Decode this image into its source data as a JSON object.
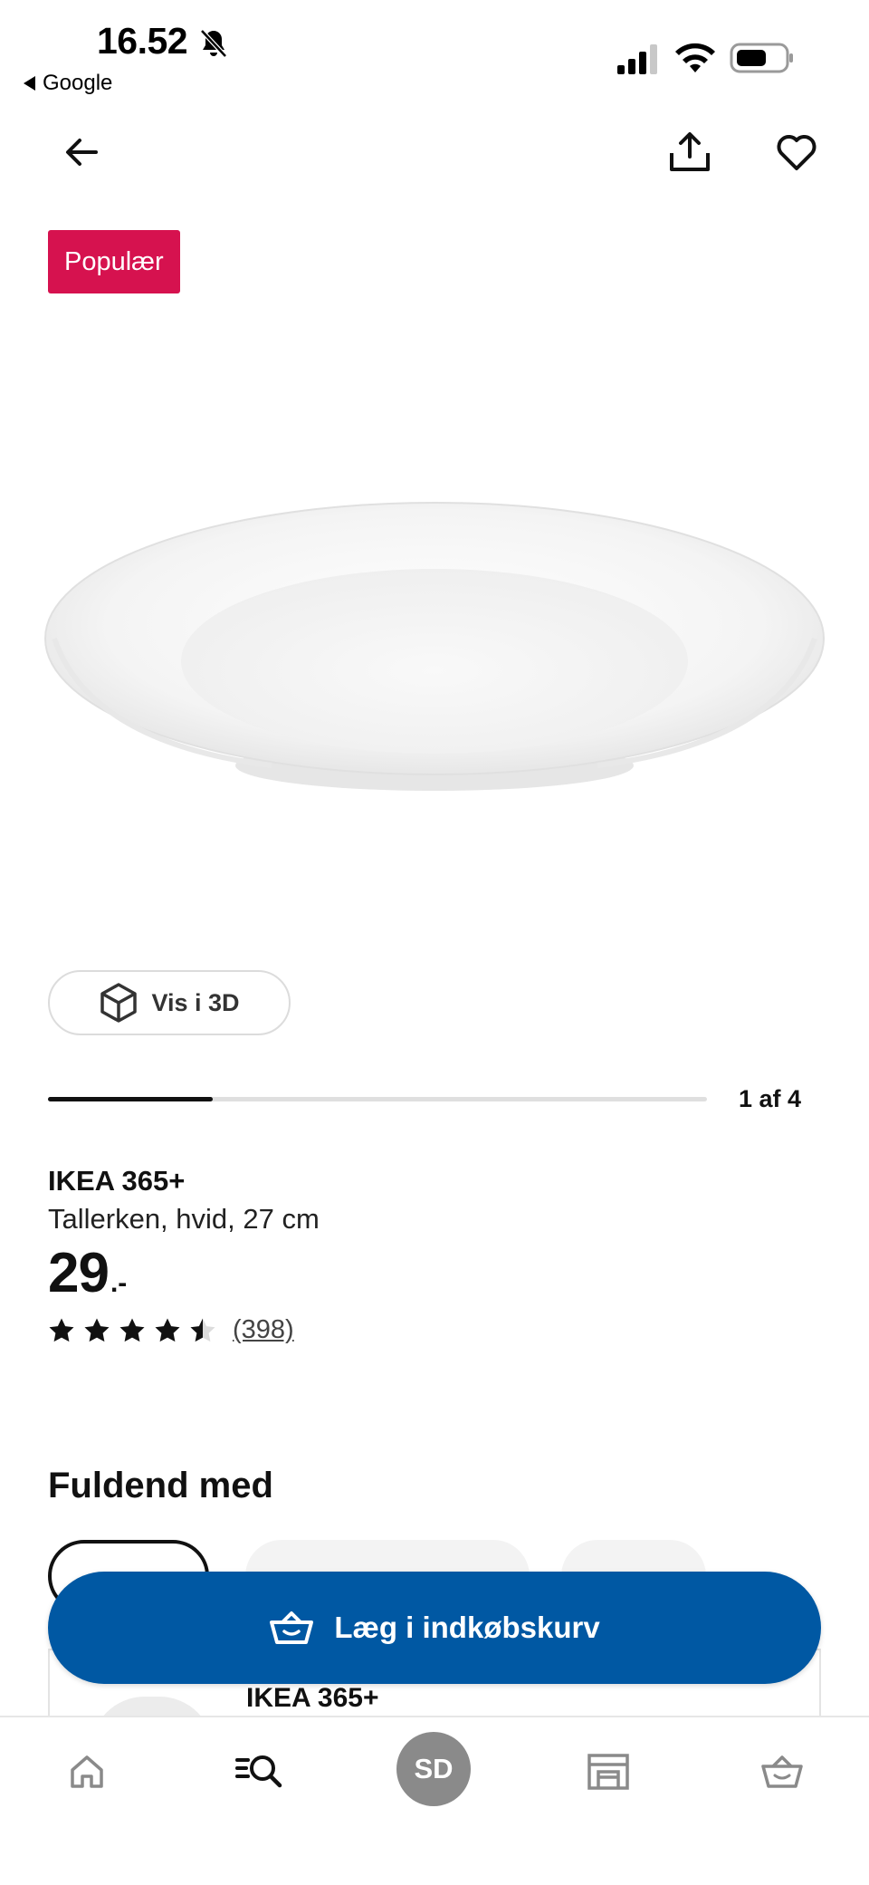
{
  "status_bar": {
    "time": "16.52",
    "back_app": "Google"
  },
  "product": {
    "badge": "Populær",
    "view_3d_label": "Vis i 3D",
    "image_index": 1,
    "image_count": 4,
    "page_indicator": "1 af 4",
    "name": "IKEA 365+",
    "description": "Tallerken, hvid, 27 cm",
    "price_main": "29",
    "price_suffix": ".-",
    "rating_value": 4.5,
    "rating_max": 5,
    "review_count": "(398)"
  },
  "complete_with": {
    "title": "Fuldend med",
    "card_name": "IKEA 365+"
  },
  "cart_button": {
    "label": "Læg i indkøbskurv"
  },
  "bottom_nav": {
    "profile_initials": "SD",
    "items": [
      "home-icon",
      "search-icon",
      "profile",
      "store-icon",
      "basket-icon"
    ]
  },
  "colors": {
    "badge": "#d6124f",
    "primary_button": "#0058a3",
    "avatar": "#8a8a8a"
  }
}
